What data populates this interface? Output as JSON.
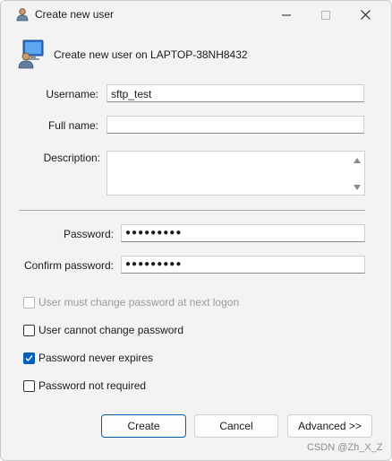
{
  "window": {
    "title": "Create new user",
    "title_icon": "user-icon"
  },
  "header": {
    "icon": "computer-user-icon",
    "text": "Create new user on LAPTOP-38NH8432"
  },
  "form": {
    "username_label": "Username:",
    "username_value": "sftp_test",
    "fullname_label": "Full name:",
    "fullname_value": "",
    "description_label": "Description:",
    "description_value": "",
    "password_label": "Password:",
    "password_value": "●●●●●●●●●",
    "confirm_label": "Confirm password:",
    "confirm_value": "●●●●●●●●●"
  },
  "options": [
    {
      "label": "User must change password at next logon",
      "checked": false,
      "disabled": true
    },
    {
      "label": "User cannot change password",
      "checked": false,
      "disabled": false
    },
    {
      "label": "Password never expires",
      "checked": true,
      "disabled": false
    },
    {
      "label": "Password not required",
      "checked": false,
      "disabled": false
    }
  ],
  "buttons": {
    "create": "Create",
    "cancel": "Cancel",
    "advanced": "Advanced >>"
  },
  "watermark": "CSDN @Zh_X_Z",
  "colors": {
    "accent": "#005fb8",
    "window_bg": "#f3f3f3"
  }
}
